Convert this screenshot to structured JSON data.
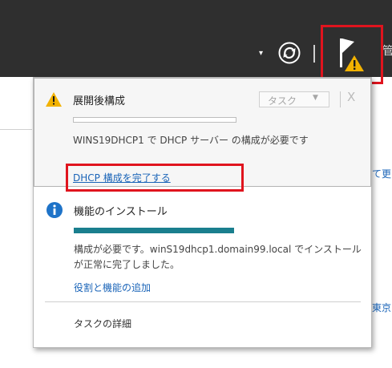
{
  "header": {
    "dropdown_arrow": "▾",
    "truncated_text": "管",
    "icons": [
      "refresh-icon",
      "notification-flag-icon",
      "warning-icon"
    ]
  },
  "background": {
    "right_text_1": "て更",
    "right_text_2": "東京"
  },
  "notifications": [
    {
      "icon": "warning-icon",
      "title": "展開後構成",
      "task_dropdown_label": "タスク",
      "close_label": "X",
      "progress": 0,
      "message": "WINS19DHCP1 で DHCP サーバー の構成が必要です",
      "action_link": "DHCP 構成を完了する"
    },
    {
      "icon": "info-icon",
      "title": "機能のインストール",
      "progress": 100,
      "message": "構成が必要です。winS19dhcp1.domain99.local でインストールが正常に完了しました。",
      "action_link": "役割と機能の追加"
    }
  ],
  "footer": {
    "task_details": "タスクの詳細"
  },
  "colors": {
    "header_bg": "#2f2f2f",
    "highlight": "#e0141e",
    "link": "#1a64b8",
    "progress_fill": "#1a7f8e",
    "warning": "#f2b200",
    "info": "#1e73c8"
  }
}
